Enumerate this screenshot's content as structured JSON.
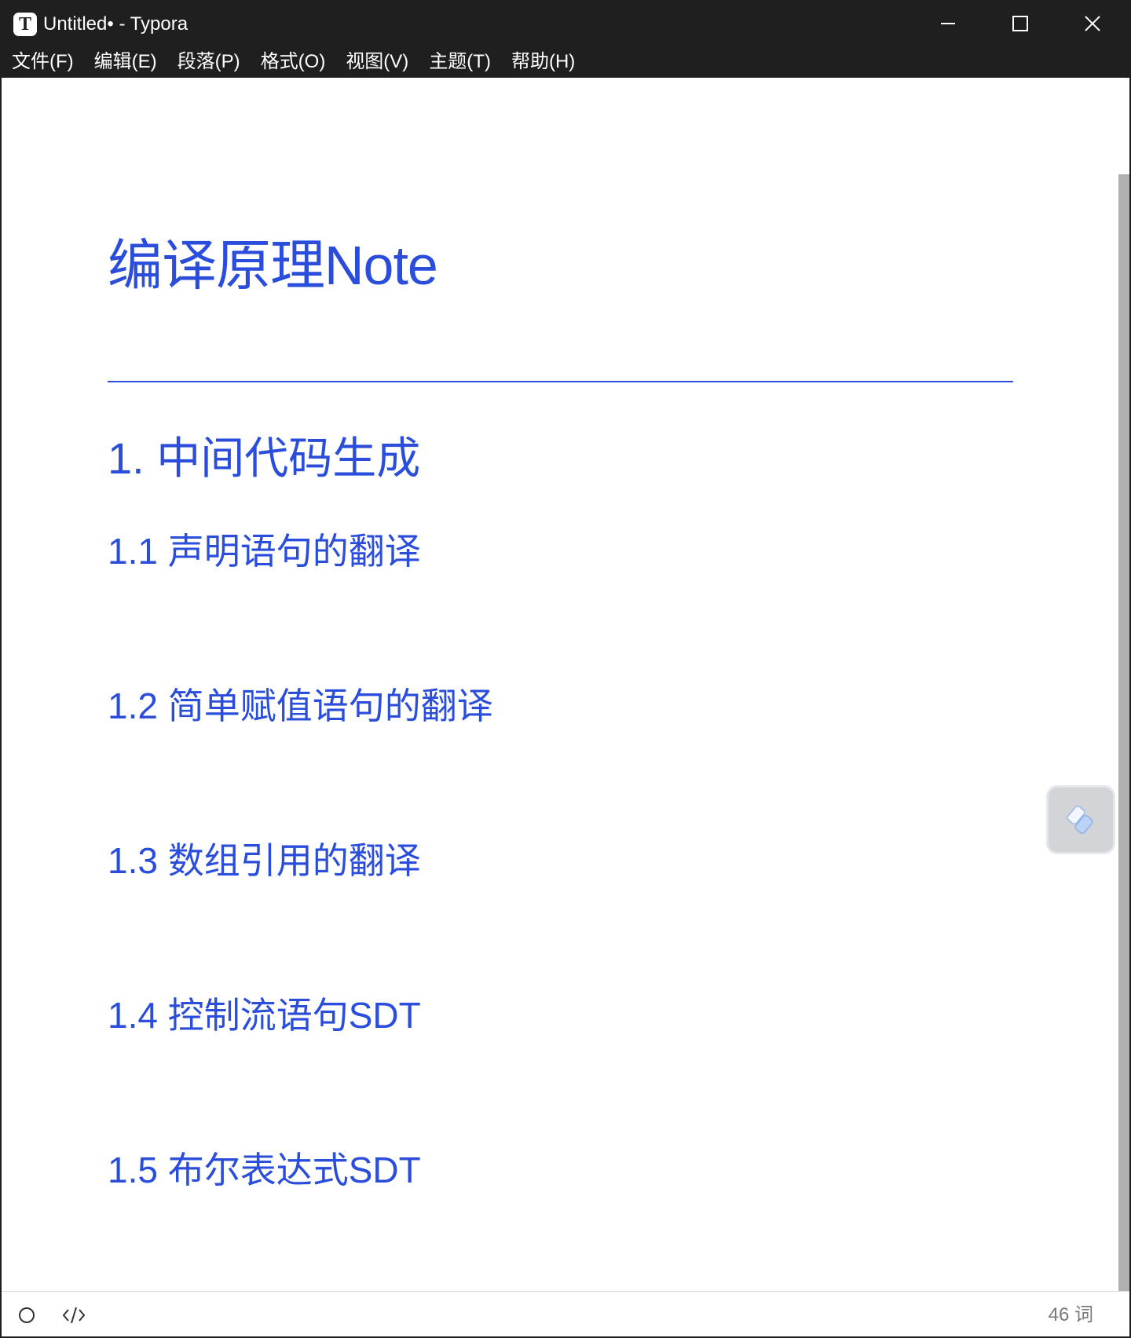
{
  "window": {
    "title": "Untitled• - Typora",
    "app_icon_letter": "T"
  },
  "menubar": {
    "items": [
      "文件(F)",
      "编辑(E)",
      "段落(P)",
      "格式(O)",
      "视图(V)",
      "主题(T)",
      "帮助(H)"
    ]
  },
  "document": {
    "title": "编译原理Note",
    "h1": "1. 中间代码生成",
    "sections": [
      "1.1 声明语句的翻译",
      "1.2 简单赋值语句的翻译",
      "1.3 数组引用的翻译",
      "1.4 控制流语句SDT",
      "1.5 布尔表达式SDT"
    ]
  },
  "statusbar": {
    "word_count": "46 词"
  },
  "colors": {
    "heading": "#2a4ddb",
    "titlebar": "#1f1f1f",
    "scrollbar_thumb": "#b0b0b0"
  },
  "icons": {
    "outline_toggle": "circle-icon",
    "source_mode": "code-icon",
    "floating_widget": "lightning-icon",
    "minimize": "minimize-icon",
    "maximize": "maximize-icon",
    "close": "close-icon"
  }
}
